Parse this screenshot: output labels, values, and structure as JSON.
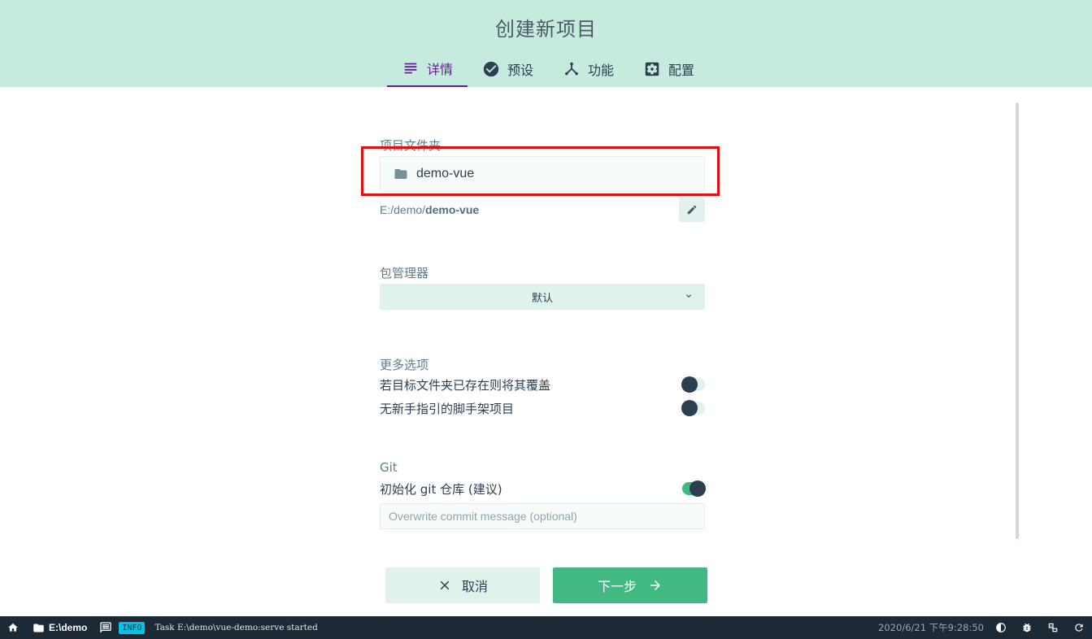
{
  "header": {
    "title": "创建新项目"
  },
  "tabs": [
    {
      "label": "详情",
      "icon": "subject-icon",
      "active": true
    },
    {
      "label": "预设",
      "icon": "check-circle-icon",
      "active": false
    },
    {
      "label": "功能",
      "icon": "call-split-icon",
      "active": false
    },
    {
      "label": "配置",
      "icon": "settings-applications-icon",
      "active": false
    }
  ],
  "folder": {
    "label": "项目文件夹",
    "value": "demo-vue",
    "path_prefix": "E:/demo/",
    "path_name": "demo-vue"
  },
  "package_manager": {
    "label": "包管理器",
    "selected": "默认"
  },
  "more_options": {
    "label": "更多选项",
    "items": [
      {
        "label": "若目标文件夹已存在则将其覆盖",
        "on": false
      },
      {
        "label": "无新手指引的脚手架项目",
        "on": false
      }
    ]
  },
  "git": {
    "label": "Git",
    "init_label": "初始化 git 仓库 (建议)",
    "init_on": true,
    "commit_placeholder": "Overwrite commit message (optional)"
  },
  "actions": {
    "cancel_label": "取消",
    "next_label": "下一步"
  },
  "statusbar": {
    "folder": "E:\\demo",
    "log_level": "INFO",
    "message": "Task E:\\demo\\vue-demo:serve started",
    "datetime": "2020/6/21 下午9:28:50"
  },
  "colors": {
    "header_bg": "#c6eade",
    "accent": "#42b983",
    "active_tab": "#6a1b9a",
    "statusbar_bg": "#1d2935",
    "highlight": "#e01010"
  }
}
